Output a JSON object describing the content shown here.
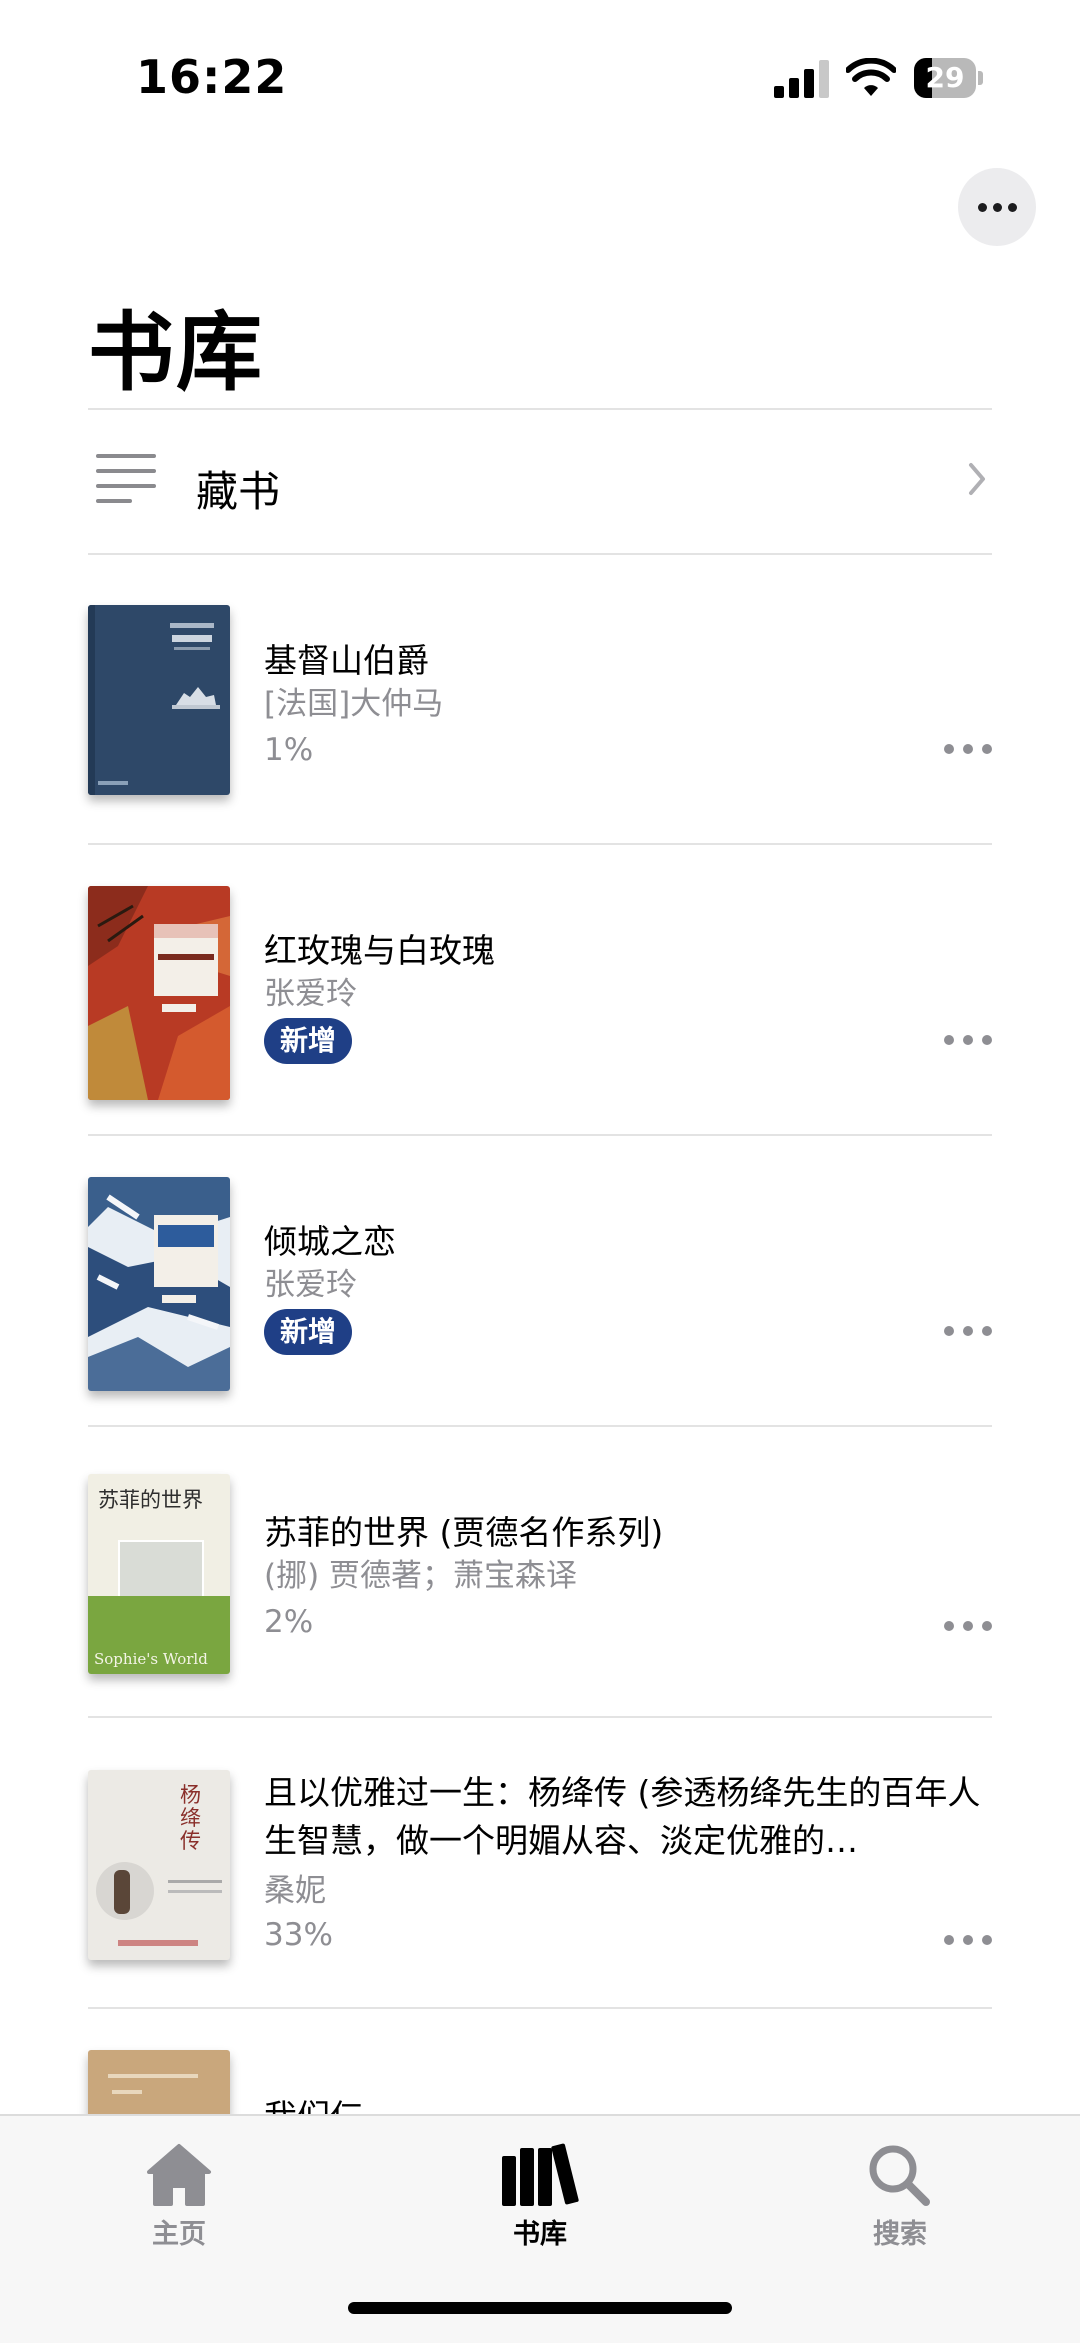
{
  "status_bar": {
    "time": "16:22",
    "battery": "29",
    "battery_level": 0.29
  },
  "header": {
    "title": "书库",
    "more_icon": "ellipsis-icon"
  },
  "collection": {
    "label": "藏书",
    "icon": "list-icon"
  },
  "books": [
    {
      "title": "基督山伯爵",
      "author": "[法国]大仲马",
      "progress": "1%"
    },
    {
      "title": "红玫瑰与白玫瑰",
      "author": "张爱玲",
      "badge": "新增"
    },
    {
      "title": "倾城之恋",
      "author": "张爱玲",
      "badge": "新增"
    },
    {
      "title": "苏菲的世界 (贾德名作系列)",
      "author": "(挪) 贾德著；萧宝森译",
      "progress": "2%"
    },
    {
      "title": "且以优雅过一生：杨绛传 (参透杨绛先生的百年人生智慧，做一个明媚从容、淡定优雅的…",
      "author": "桑妮",
      "progress": "33%"
    },
    {
      "title": "我们仨"
    }
  ],
  "covers": {
    "sophie_cn": "苏菲的世界",
    "sophie_en": "Sophie's World",
    "yangjiang_title": "杨绛传"
  },
  "tab_bar": {
    "home": "主页",
    "library": "书库",
    "search": "搜索",
    "active": "library"
  },
  "colors": {
    "accent_badge": "#1f3f86",
    "secondary_text": "#8e8e93"
  }
}
